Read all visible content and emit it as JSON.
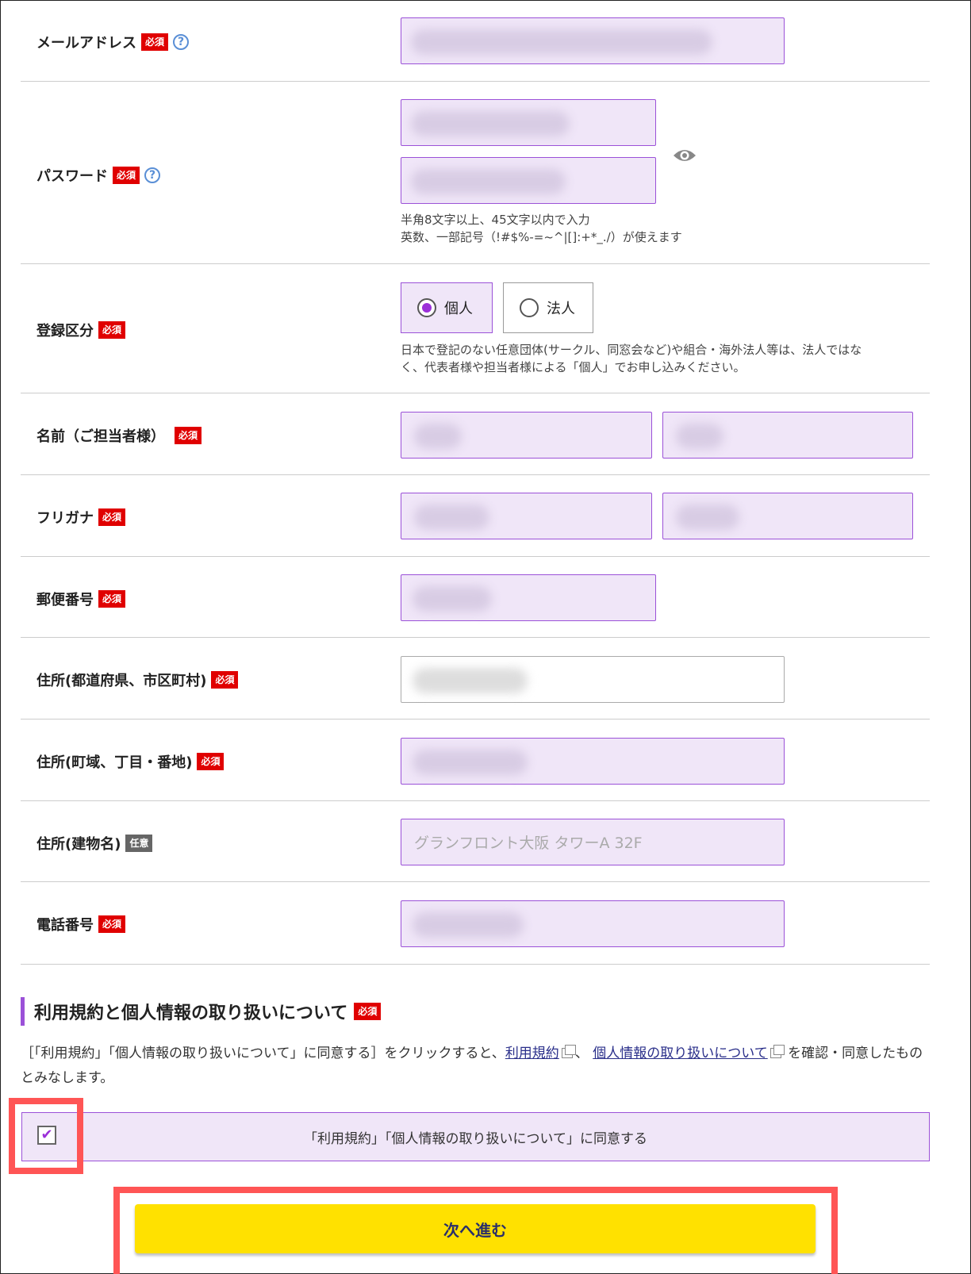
{
  "badges": {
    "required": "必須",
    "optional": "任意"
  },
  "fields": {
    "email": {
      "label": "メールアドレス"
    },
    "password": {
      "label": "パスワード",
      "hint1": "半角8文字以上、45文字以内で入力",
      "hint2": "英数、一部記号（!#$%-=~^|[]:+*_./）が使えます"
    },
    "registration_type": {
      "label": "登録区分",
      "options": [
        "個人",
        "法人"
      ],
      "selected": "個人",
      "hint1": "日本で登記のない任意団体(サークル、同窓会など)や組合・海外法人等は、法人ではな",
      "hint2": "く、代表者様や担当者様による「個人」でお申し込みください。"
    },
    "name": {
      "label": "名前（ご担当者様）"
    },
    "furigana": {
      "label": "フリガナ"
    },
    "postal_code": {
      "label": "郵便番号"
    },
    "address_pref_city": {
      "label": "住所(都道府県、市区町村)"
    },
    "address_town": {
      "label": "住所(町域、丁目・番地)"
    },
    "address_building": {
      "label": "住所(建物名)",
      "placeholder": "グランフロント大阪 タワーA 32F"
    },
    "phone": {
      "label": "電話番号"
    }
  },
  "terms": {
    "title": "利用規約と個人情報の取り扱いについて",
    "text_prefix": "［「利用規約」「個人情報の取り扱いについて」に同意する］をクリックすると、",
    "link1": "利用規約",
    "sep": "、",
    "link2": "個人情報の取り扱いについて",
    "text_suffix": "を確認・同意したものとみなします。",
    "checkbox_label": "「利用規約」「個人情報の取り扱いについて」に同意する",
    "checked": true
  },
  "next_button": "次へ進む",
  "icons": {
    "help": "question-circle-icon",
    "eye": "eye-icon",
    "external": "external-link-icon",
    "check": "checkmark-icon"
  },
  "colors": {
    "accent": "#9b51d8",
    "required_badge": "#e00000",
    "button": "#ffe100",
    "highlight": "#ff5555"
  }
}
